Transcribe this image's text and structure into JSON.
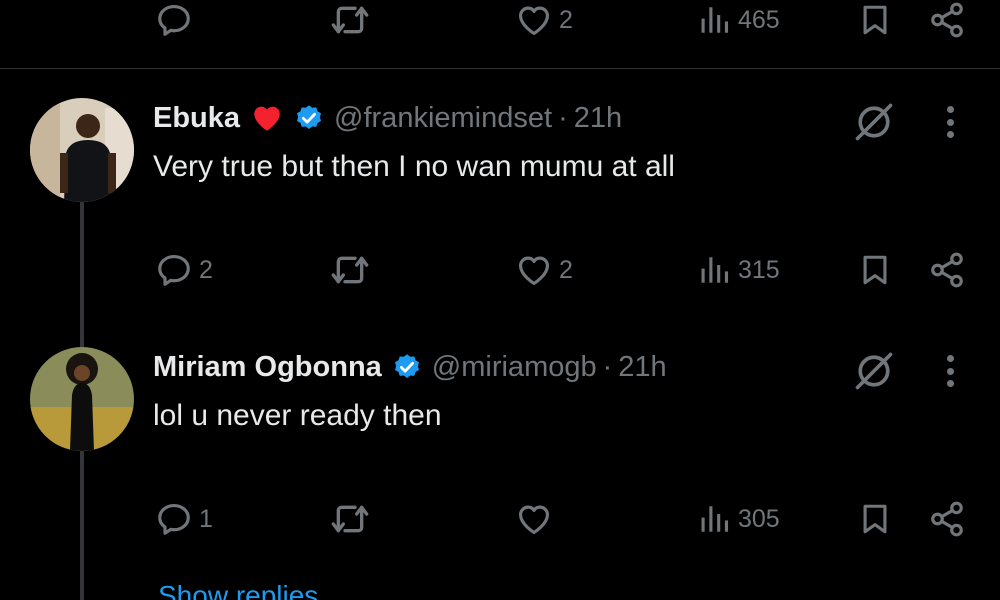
{
  "colors": {
    "background": "#000000",
    "text": "#e7e9ea",
    "muted": "#71767b",
    "accent": "#1d9bf0",
    "verified": "#1d9bf0",
    "heart": "#f91880"
  },
  "top_actions": {
    "reply_count": "",
    "repost_count": "",
    "like_count": "2",
    "view_count": "465"
  },
  "tweets": [
    {
      "name": "Ebuka",
      "name_emoji": "heart-emoji",
      "verified": true,
      "handle": "@frankiemindset",
      "separator": "·",
      "time": "21h",
      "text": "Very true but then I no wan mumu at all",
      "reply_count": "2",
      "repost_count": "",
      "like_count": "2",
      "view_count": "315"
    },
    {
      "name": "Miriam Ogbonna",
      "verified": true,
      "handle": "@miriamogb",
      "separator": "·",
      "time": "21h",
      "text": "lol u never ready then",
      "reply_count": "1",
      "repost_count": "",
      "like_count": "",
      "view_count": "305"
    }
  ],
  "show_replies_label": "Show replies"
}
